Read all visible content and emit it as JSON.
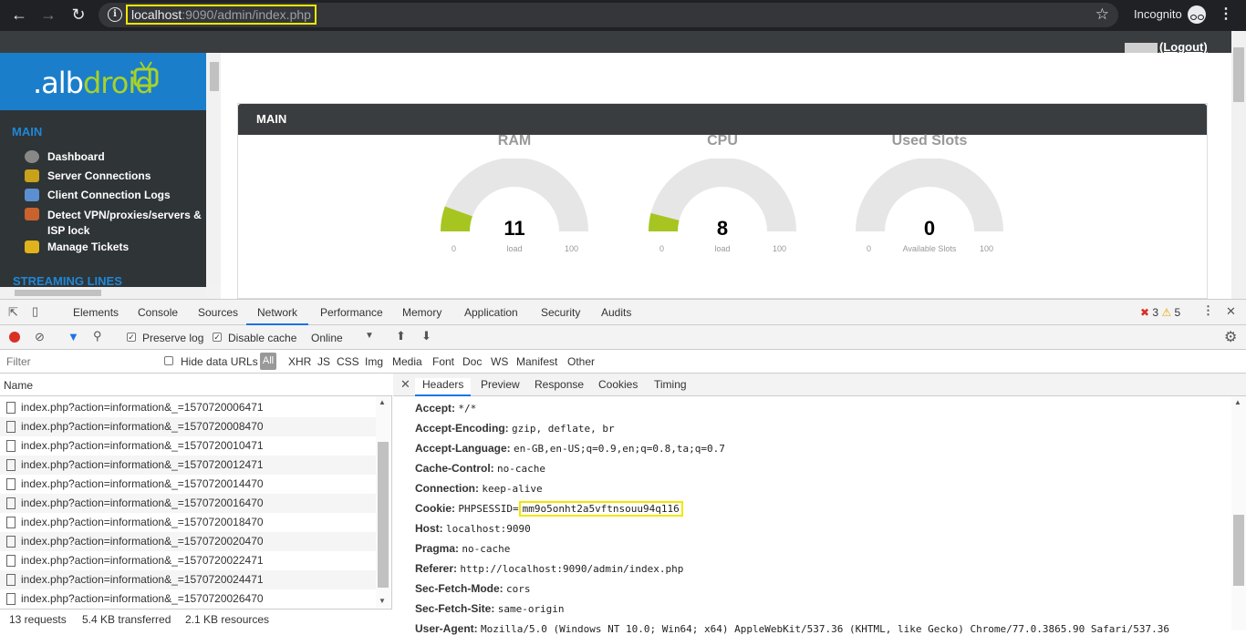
{
  "browser": {
    "url_host": "localhost",
    "url_rest": ":9090/admin/index.php",
    "profile": "Incognito"
  },
  "app": {
    "logout": "(Logout)",
    "logo_white": ".alb",
    "logo_green": "droid",
    "sidebar": {
      "section_main": "MAIN",
      "items": [
        {
          "label": "Dashboard",
          "icon": "dashboard-icon"
        },
        {
          "label": "Server Connections",
          "icon": "server-icon"
        },
        {
          "label": "Client Connection Logs",
          "icon": "logs-icon"
        },
        {
          "label": "Detect VPN/proxies/servers &",
          "label2": "ISP lock",
          "icon": "firewall-icon"
        },
        {
          "label": "Manage Tickets",
          "icon": "ticket-icon"
        }
      ],
      "section_streaming": "STREAMING LINES"
    },
    "panel_title": "MAIN",
    "gauges": [
      {
        "title": "RAM",
        "value": "11",
        "label": "load",
        "min": "0",
        "max": "100",
        "fill": 0.11
      },
      {
        "title": "CPU",
        "value": "8",
        "label": "load",
        "min": "0",
        "max": "100",
        "fill": 0.08
      },
      {
        "title": "Used Slots",
        "value": "0",
        "label": "Available Slots",
        "min": "0",
        "max": "100",
        "fill": 0
      }
    ],
    "colors": {
      "gauge_fill": "#a7c520",
      "gauge_bg": "#e6e6e6",
      "accent": "#1a7ecb"
    }
  },
  "devtools": {
    "tabs": [
      "Elements",
      "Console",
      "Sources",
      "Network",
      "Performance",
      "Memory",
      "Application",
      "Security",
      "Audits"
    ],
    "active_tab": "Network",
    "errors": "3",
    "warnings": "5",
    "preserve_log": "Preserve log",
    "disable_cache": "Disable cache",
    "throttle": "Online",
    "filter_placeholder": "Filter",
    "hide_data_urls": "Hide data URLs",
    "filter_types": [
      "All",
      "XHR",
      "JS",
      "CSS",
      "Img",
      "Media",
      "Font",
      "Doc",
      "WS",
      "Manifest",
      "Other"
    ],
    "name_header": "Name",
    "requests": [
      "index.php?action=information&_=1570720006471",
      "index.php?action=information&_=1570720008470",
      "index.php?action=information&_=1570720010471",
      "index.php?action=information&_=1570720012471",
      "index.php?action=information&_=1570720014470",
      "index.php?action=information&_=1570720016470",
      "index.php?action=information&_=1570720018470",
      "index.php?action=information&_=1570720020470",
      "index.php?action=information&_=1570720022471",
      "index.php?action=information&_=1570720024471",
      "index.php?action=information&_=1570720026470"
    ],
    "summary": {
      "requests": "13 requests",
      "transferred": "5.4 KB transferred",
      "resources": "2.1 KB resources"
    },
    "detail_tabs": [
      "Headers",
      "Preview",
      "Response",
      "Cookies",
      "Timing"
    ],
    "active_detail_tab": "Headers",
    "headers": [
      {
        "k": "Accept:",
        "v": "*/*"
      },
      {
        "k": "Accept-Encoding:",
        "v": "gzip, deflate, br"
      },
      {
        "k": "Accept-Language:",
        "v": "en-GB,en-US;q=0.9,en;q=0.8,ta;q=0.7"
      },
      {
        "k": "Cache-Control:",
        "v": "no-cache"
      },
      {
        "k": "Connection:",
        "v": "keep-alive"
      },
      {
        "k": "Cookie:",
        "v": "PHPSESSID=",
        "v2": "mm9o5onht2a5vftnsouu94q116"
      },
      {
        "k": "Host:",
        "v": "localhost:9090"
      },
      {
        "k": "Pragma:",
        "v": "no-cache"
      },
      {
        "k": "Referer:",
        "v": "http://localhost:9090/admin/index.php"
      },
      {
        "k": "Sec-Fetch-Mode:",
        "v": "cors"
      },
      {
        "k": "Sec-Fetch-Site:",
        "v": "same-origin"
      },
      {
        "k": "User-Agent:",
        "v": "Mozilla/5.0 (Windows NT 10.0; Win64; x64) AppleWebKit/537.36 (KHTML, like Gecko) Chrome/77.0.3865.90 Safari/537.36"
      }
    ]
  }
}
